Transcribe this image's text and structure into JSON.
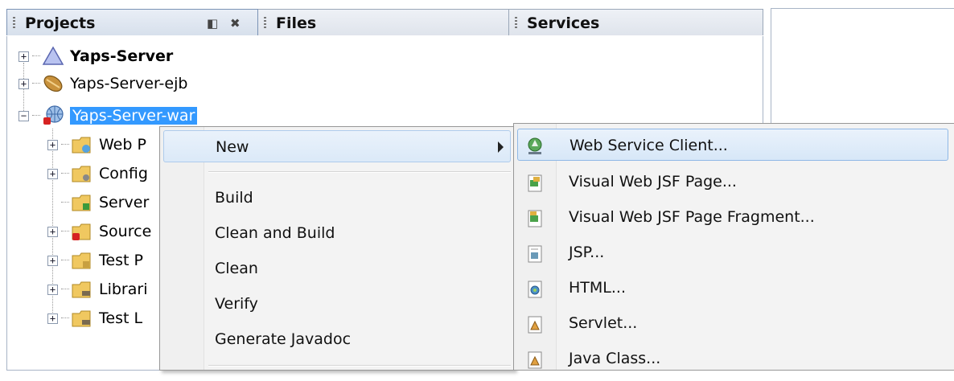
{
  "tabs": [
    {
      "label": "Projects",
      "active": true
    },
    {
      "label": "Files",
      "active": false
    },
    {
      "label": "Services",
      "active": false
    }
  ],
  "tab_controls": {
    "minimize_icon": "minimize-window-icon",
    "close_icon": "close-tab-icon"
  },
  "tree": {
    "projects": [
      {
        "label": "Yaps-Server",
        "bold": true,
        "icon": "enterprise-app-icon"
      },
      {
        "label": "Yaps-Server-ejb",
        "icon": "ejb-bean-icon"
      },
      {
        "label": "Yaps-Server-war",
        "selected": true,
        "icon": "web-app-icon"
      }
    ],
    "children": [
      {
        "label": "Web P",
        "icon": "web-pages-folder-icon"
      },
      {
        "label": "Config",
        "icon": "config-folder-icon"
      },
      {
        "label": "Server",
        "icon": "server-folder-icon"
      },
      {
        "label": "Source",
        "icon": "source-folder-icon"
      },
      {
        "label": "Test P",
        "icon": "test-packages-folder-icon"
      },
      {
        "label": "Librari",
        "icon": "libraries-folder-icon"
      },
      {
        "label": "Test L",
        "icon": "test-libraries-folder-icon"
      }
    ]
  },
  "context_menu": {
    "new": "New",
    "items": [
      "Build",
      "Clean and Build",
      "Clean",
      "Verify",
      "Generate Javadoc"
    ]
  },
  "submenu": {
    "items": [
      {
        "label": "Web Service Client...",
        "icon": "web-service-client-icon"
      },
      {
        "label": "Visual Web JSF Page...",
        "icon": "jsf-page-icon"
      },
      {
        "label": "Visual Web JSF Page Fragment...",
        "icon": "jsf-fragment-icon"
      },
      {
        "label": "JSP...",
        "icon": "jsp-file-icon"
      },
      {
        "label": "HTML...",
        "icon": "html-file-icon"
      },
      {
        "label": "Servlet...",
        "icon": "servlet-icon"
      },
      {
        "label": "Java Class...",
        "icon": "java-class-icon"
      }
    ]
  },
  "colors": {
    "selection": "#3399ff",
    "menu_highlight": "#dbe9f8",
    "tab_border": "#9aa7b8"
  }
}
